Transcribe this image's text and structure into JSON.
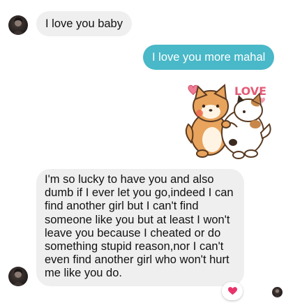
{
  "conversation": {
    "messages": [
      {
        "direction": "incoming",
        "text": "I love you baby"
      },
      {
        "direction": "outgoing",
        "text": "I love you more mahal"
      },
      {
        "direction": "outgoing",
        "type": "sticker",
        "sticker_text": "LOVE"
      },
      {
        "direction": "incoming",
        "text": "I'm so lucky to have you and also dumb if I ever let you go,indeed I can find another girl but I can't find someone like you but at least I won't leave you because I cheated or do something stupid reason,nor I can't even find another girl who won't hurt me like you do."
      }
    ],
    "reaction": {
      "icon": "heart-icon",
      "color": "#e9336b"
    }
  },
  "colors": {
    "incoming_bubble": "#efefef",
    "outgoing_bubble": "#49b8c8",
    "sticker_text": "#e35b77"
  }
}
